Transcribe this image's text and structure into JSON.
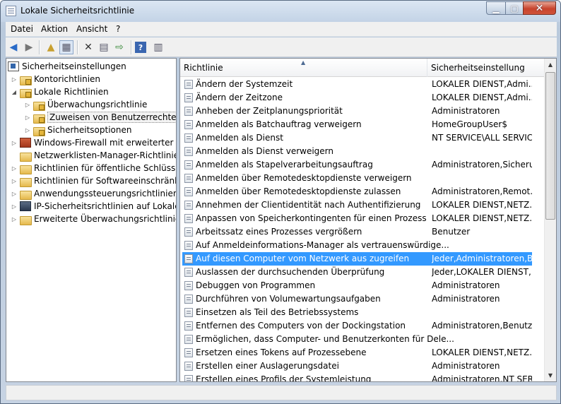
{
  "window": {
    "title": "Lokale Sicherheitsrichtlinie"
  },
  "menu": [
    "Datei",
    "Aktion",
    "Ansicht",
    "?"
  ],
  "tree": [
    {
      "label": "Sicherheitseinstellungen",
      "level": 0,
      "icon": "security-settings-icon",
      "expander": ""
    },
    {
      "label": "Kontorichtlinien",
      "level": 1,
      "icon": "folder-lock-icon",
      "expander": "collapsed"
    },
    {
      "label": "Lokale Richtlinien",
      "level": 1,
      "icon": "folder-lock-icon",
      "expander": "expanded"
    },
    {
      "label": "Überwachungsrichtlinie",
      "level": 2,
      "icon": "folder-lock-icon",
      "expander": "collapsed"
    },
    {
      "label": "Zuweisen von Benutzerrechten",
      "level": 2,
      "icon": "folder-lock-icon",
      "expander": "collapsed",
      "selected": true
    },
    {
      "label": "Sicherheitsoptionen",
      "level": 2,
      "icon": "folder-lock-icon",
      "expander": "collapsed"
    },
    {
      "label": "Windows-Firewall mit erweiterter Sich",
      "level": 1,
      "icon": "firewall-icon",
      "expander": "collapsed"
    },
    {
      "label": "Netzwerklisten-Manager-Richtlinien",
      "level": 1,
      "icon": "folder-icon",
      "expander": ""
    },
    {
      "label": "Richtlinien für öffentliche Schlüssel",
      "level": 1,
      "icon": "folder-icon",
      "expander": "collapsed"
    },
    {
      "label": "Richtlinien für Softwareeinschränkung",
      "level": 1,
      "icon": "folder-icon",
      "expander": "collapsed"
    },
    {
      "label": "Anwendungssteuerungsrichtlinien",
      "level": 1,
      "icon": "folder-icon",
      "expander": "collapsed"
    },
    {
      "label": "IP-Sicherheitsrichtlinien auf Lokaler C",
      "level": 1,
      "icon": "ip-security-icon",
      "expander": "collapsed"
    },
    {
      "label": "Erweiterte Überwachungsrichtlinienk",
      "level": 1,
      "icon": "folder-icon",
      "expander": "collapsed"
    }
  ],
  "list": {
    "columns": [
      "Richtlinie",
      "Sicherheitseinstellung"
    ],
    "rows": [
      {
        "name": "Ändern der Systemzeit",
        "value": "LOKALER DIENST,Admi..."
      },
      {
        "name": "Ändern der Zeitzone",
        "value": "LOKALER DIENST,Admi..."
      },
      {
        "name": "Anheben der Zeitplanungspriorität",
        "value": "Administratoren"
      },
      {
        "name": "Anmelden als Batchauftrag verweigern",
        "value": "HomeGroupUser$"
      },
      {
        "name": "Anmelden als Dienst",
        "value": "NT SERVICE\\ALL SERVIC..."
      },
      {
        "name": "Anmelden als Dienst verweigern",
        "value": ""
      },
      {
        "name": "Anmelden als Stapelverarbeitungsauftrag",
        "value": "Administratoren,Sicheru..."
      },
      {
        "name": "Anmelden über Remotedesktopdienste verweigern",
        "value": ""
      },
      {
        "name": "Anmelden über Remotedesktopdienste zulassen",
        "value": "Administratoren,Remot..."
      },
      {
        "name": "Annehmen der Clientidentität nach Authentifizierung",
        "value": "LOKALER DIENST,NETZ..."
      },
      {
        "name": "Anpassen von Speicherkontingenten für einen Prozess",
        "value": "LOKALER DIENST,NETZ..."
      },
      {
        "name": "Arbeitssatz eines Prozesses vergrößern",
        "value": "Benutzer"
      },
      {
        "name": "Auf Anmeldeinformations-Manager als vertrauenswürdige...",
        "value": ""
      },
      {
        "name": "Auf diesen Computer vom Netzwerk aus zugreifen",
        "value": "Jeder,Administratoren,B...",
        "selected": true
      },
      {
        "name": "Auslassen der durchsuchenden Überprüfung",
        "value": "Jeder,LOKALER DIENST,..."
      },
      {
        "name": "Debuggen von Programmen",
        "value": "Administratoren"
      },
      {
        "name": "Durchführen von Volumewartungsaufgaben",
        "value": "Administratoren"
      },
      {
        "name": "Einsetzen als Teil des Betriebssystems",
        "value": ""
      },
      {
        "name": "Entfernen des Computers von der Dockingstation",
        "value": "Administratoren,Benutzer"
      },
      {
        "name": "Ermöglichen, dass Computer- und Benutzerkonten für Dele...",
        "value": ""
      },
      {
        "name": "Ersetzen eines Tokens auf Prozessebene",
        "value": "LOKALER DIENST,NETZ..."
      },
      {
        "name": "Erstellen einer Auslagerungsdatei",
        "value": "Administratoren"
      },
      {
        "name": "Erstellen eines Profils der Systemleistung",
        "value": "Administratoren,NT SER..."
      }
    ]
  }
}
